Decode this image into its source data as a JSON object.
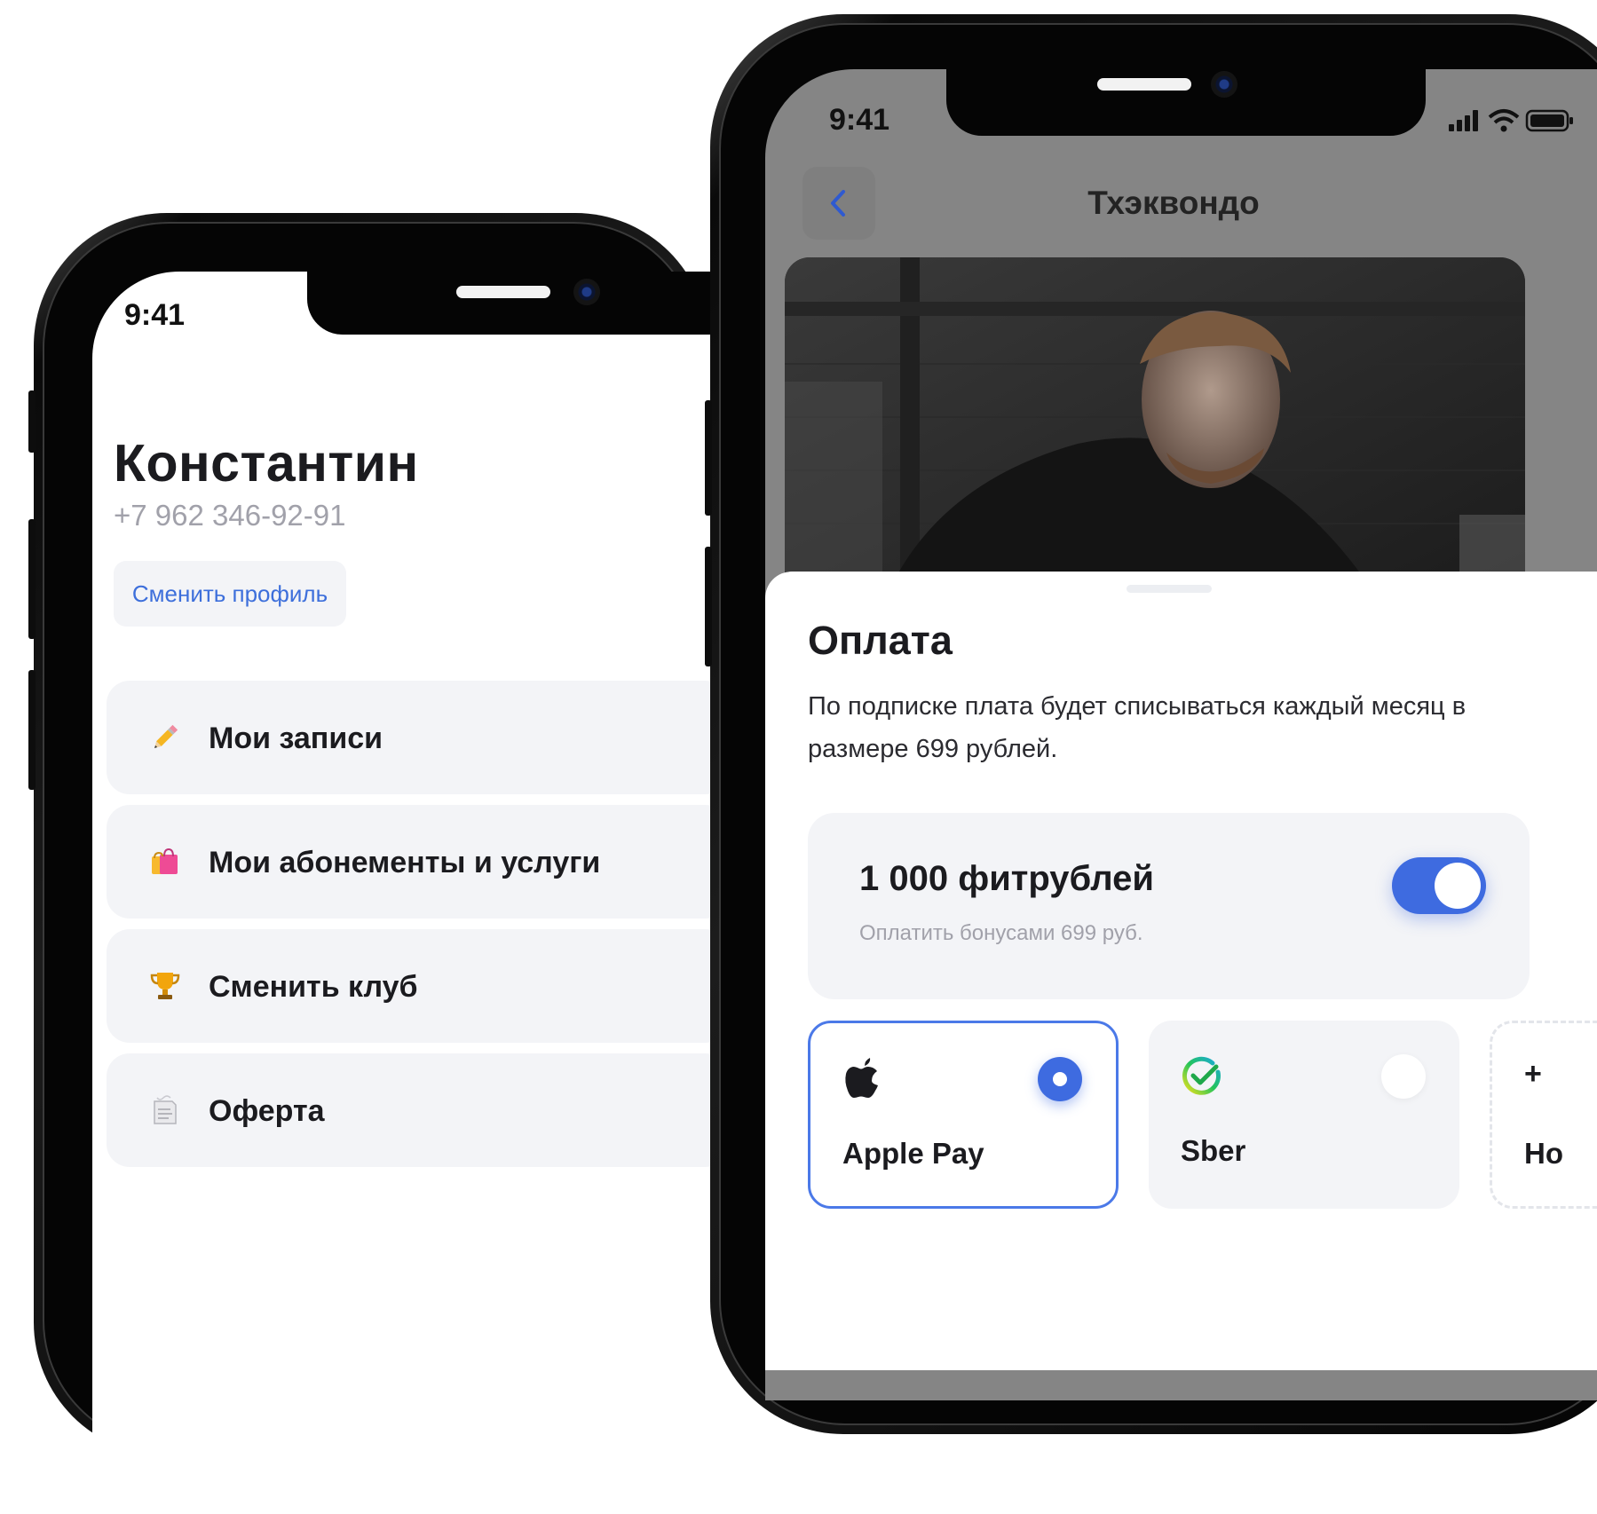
{
  "left_phone": {
    "status_time": "9:41",
    "profile": {
      "name": "Константин",
      "phone": "+7 962 346-92-91",
      "switch_profile_label": "Сменить профиль"
    },
    "menu": [
      {
        "label": "Мои записи",
        "icon": "pencil-icon"
      },
      {
        "label": "Мои абонементы и услуги",
        "icon": "shopping-bags-icon"
      },
      {
        "label": "Сменить клуб",
        "icon": "trophy-icon"
      },
      {
        "label": "Оферта",
        "icon": "document-icon"
      }
    ]
  },
  "right_phone": {
    "status_time": "9:41",
    "header": {
      "title": "Тхэквондо",
      "back_icon": "chevron-left-icon"
    },
    "payment_sheet": {
      "title": "Оплата",
      "description": "По подписке плата будет списываться каждый месяц в размере 699 рублей.",
      "bonus": {
        "amount": "1 000 фитрублей",
        "subtitle": "Оплатить бонусами 699 руб.",
        "enabled": true
      },
      "methods": [
        {
          "label": "Apple Pay",
          "icon": "apple-icon",
          "selected": true
        },
        {
          "label": "Sber",
          "icon": "sber-icon",
          "selected": false
        },
        {
          "label": "Но",
          "icon": "plus-icon",
          "plus_symbol": "+"
        }
      ]
    }
  },
  "colors": {
    "accent": "#3e6be0",
    "card_bg": "#f3f4f7",
    "text_primary": "#1b1b1f",
    "text_secondary": "#a1a1aa"
  }
}
